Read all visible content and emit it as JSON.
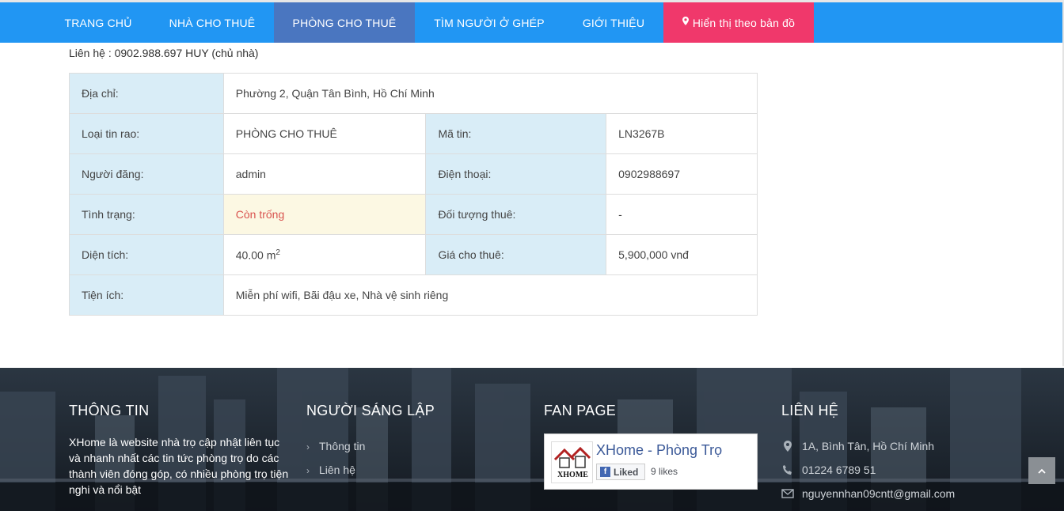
{
  "nav": {
    "items": [
      {
        "label": "TRANG CHỦ"
      },
      {
        "label": "NHÀ CHO THUÊ"
      },
      {
        "label": "PHÒNG CHO THUÊ"
      },
      {
        "label": "TÌM NGƯỜI Ở GHÉP"
      },
      {
        "label": "GIỚI THIỆU"
      }
    ],
    "map_button": "Hiển thị theo bản đồ",
    "active_color": "#4a76c0",
    "bar_color": "#2196f3",
    "map_color": "#f0386b"
  },
  "contact_line": "Liên hệ : 0902.988.697 HUY (chủ nhà)",
  "details": {
    "address_label": "Địa chỉ:",
    "address_value": "Phường 2, Quận Tân Bình, Hồ Chí Minh",
    "type_label": "Loại tin rao:",
    "type_value": "PHÒNG CHO THUÊ",
    "code_label": "Mã tin:",
    "code_value": "LN3267B",
    "poster_label": "Người đăng:",
    "poster_value": "admin",
    "phone_label": "Điện thoại:",
    "phone_value": "0902988697",
    "status_label": "Tình trạng:",
    "status_value": "Còn trống",
    "tenant_label": "Đối tượng thuê:",
    "tenant_value": "-",
    "area_label": "Diện tích:",
    "area_value": "40.00 m",
    "area_unit_sup": "2",
    "price_label": "Giá cho thuê:",
    "price_value": "5,900,000 vnđ",
    "amenities_label": "Tiện ích:",
    "amenities_value": "Miễn phí wifi, Bãi đậu xe, Nhà vệ sinh riêng"
  },
  "footer": {
    "info_title": "THÔNG TIN",
    "info_text": "XHome là website nhà trọ cập nhật liên tục và nhanh nhất các tin tức phòng trọ do các thành viên đóng góp, có nhiều phòng trọ tiện nghi và nổi bật",
    "founder_title": "NGƯỜI SÁNG LẬP",
    "founder_links": [
      "Thông tin",
      "Liên hệ"
    ],
    "fanpage_title": "FAN PAGE",
    "fb_page_name": "XHome - Phòng Trọ",
    "fb_logo_text": "XHOME",
    "fb_liked": "Liked",
    "fb_likes": "9 likes",
    "contact_title": "LIÊN HỆ",
    "address": "1A, Bình Tân, Hồ Chí Minh",
    "phone": "01224 6789 51",
    "email": "nguyennhan09cntt@gmail.com"
  },
  "icons": {
    "pin": "map-pin-icon",
    "chevron": "chevron-right-icon",
    "phone": "phone-icon",
    "mail": "envelope-icon",
    "back_to_top": "chevron-up-icon"
  }
}
